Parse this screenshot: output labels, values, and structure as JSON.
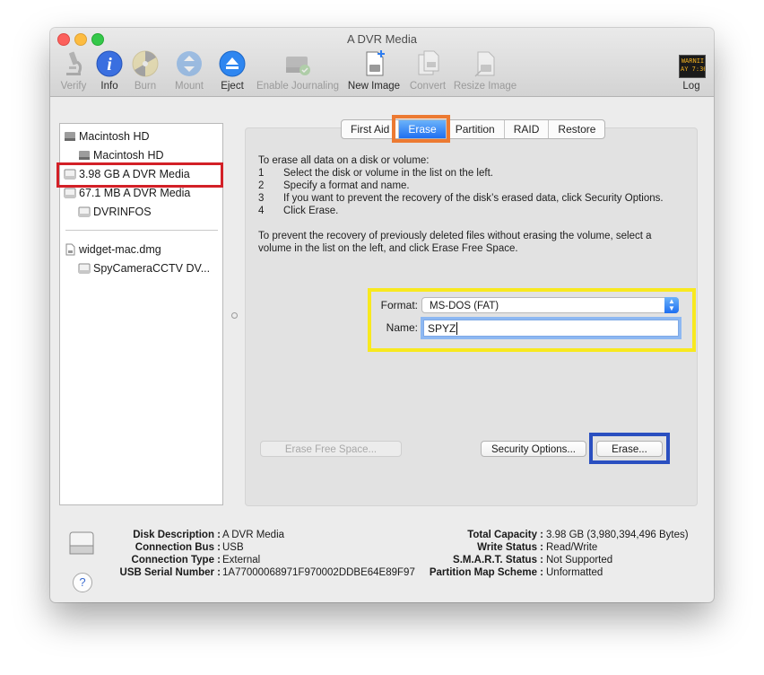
{
  "window": {
    "title": "A DVR Media"
  },
  "toolbar": {
    "items": [
      {
        "label": "Verify",
        "icon": "microscope-icon"
      },
      {
        "label": "Info",
        "icon": "info-icon"
      },
      {
        "label": "Burn",
        "icon": "burn-icon"
      },
      {
        "label": "Mount",
        "icon": "mount-icon"
      },
      {
        "label": "Eject",
        "icon": "eject-icon"
      },
      {
        "label": "Enable Journaling",
        "icon": "journaling-icon"
      },
      {
        "label": "New Image",
        "icon": "new-image-icon"
      },
      {
        "label": "Convert",
        "icon": "convert-icon"
      },
      {
        "label": "Resize Image",
        "icon": "resize-image-icon"
      }
    ],
    "log": {
      "label": "Log",
      "badge_top": "WARNII",
      "badge_bottom": "AY 7:36"
    }
  },
  "sidebar": {
    "items": [
      {
        "label": "Macintosh HD",
        "icon": "internal-disk-icon"
      },
      {
        "label": "Macintosh HD",
        "icon": "internal-disk-icon"
      },
      {
        "label": "3.98 GB A DVR Media",
        "icon": "external-disk-icon"
      },
      {
        "label": "67.1 MB A DVR Media",
        "icon": "external-disk-icon"
      },
      {
        "label": "DVRINFOS",
        "icon": "volume-icon"
      },
      {
        "label": "widget-mac.dmg",
        "icon": "dmg-file-icon"
      },
      {
        "label": "SpyCameraCCTV DV...",
        "icon": "volume-icon"
      }
    ]
  },
  "tabs": [
    "First Aid",
    "Erase",
    "Partition",
    "RAID",
    "Restore"
  ],
  "erase": {
    "intro": "To erase all data on a disk or volume:",
    "steps": [
      {
        "n": "1",
        "text": "Select the disk or volume in the list on the left."
      },
      {
        "n": "2",
        "text": "Specify a format and name."
      },
      {
        "n": "3",
        "text": "If you want to prevent the recovery of the disk’s erased data, click Security Options."
      },
      {
        "n": "4",
        "text": "Click Erase."
      }
    ],
    "free_space_note": "To prevent the recovery of previously deleted files without erasing the volume, select a volume in the list on the left, and click Erase Free Space.",
    "format_label": "Format:",
    "format_value": "MS-DOS (FAT)",
    "name_label": "Name:",
    "name_value": "SPYZ",
    "erase_free_space_button": "Erase Free Space...",
    "security_options_button": "Security Options...",
    "erase_button": "Erase..."
  },
  "info": {
    "left": [
      {
        "label": "Disk Description :",
        "value": "A DVR Media"
      },
      {
        "label": "Connection Bus :",
        "value": "USB"
      },
      {
        "label": "Connection Type :",
        "value": "External"
      },
      {
        "label": "USB Serial Number :",
        "value": "1A77000068971F970002DDBE64E89F97"
      }
    ],
    "right": [
      {
        "label": "Total Capacity :",
        "value": "3.98 GB (3,980,394,496 Bytes)"
      },
      {
        "label": "Write Status :",
        "value": "Read/Write"
      },
      {
        "label": "S.M.A.R.T. Status :",
        "value": "Not Supported"
      },
      {
        "label": "Partition Map Scheme :",
        "value": "Unformatted"
      }
    ],
    "help": "?"
  },
  "colors": {
    "selection_accent": "#1e6ff1",
    "highlight_red": "#d32027",
    "highlight_orange": "#ec7a32",
    "highlight_yellow": "#f8e91f",
    "highlight_blue": "#2a4fc0"
  }
}
